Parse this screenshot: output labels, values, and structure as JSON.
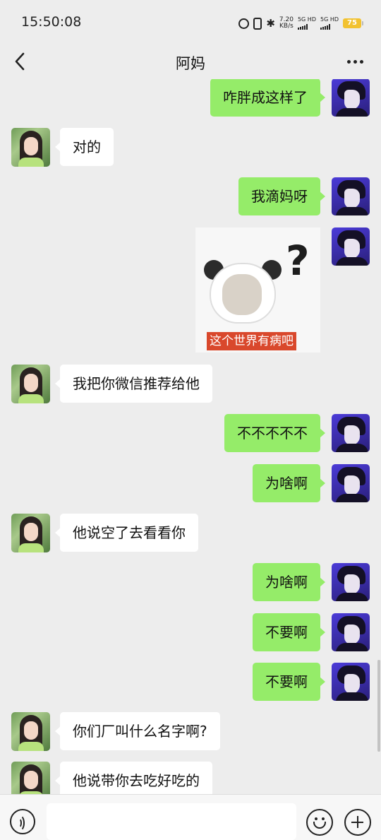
{
  "status_bar": {
    "time": "15:50:08",
    "net_speed_value": "7.20",
    "net_speed_unit": "KB/s",
    "sim1_label": "5G HD",
    "sim2_label": "5G HD",
    "battery": "75",
    "icons": [
      "alarm-icon",
      "vibrate-icon",
      "bluetooth-icon",
      "signal-icon",
      "battery-icon"
    ]
  },
  "header": {
    "title": "阿妈",
    "back_icon": "chevron-left-icon",
    "more_icon": "more-dots-icon"
  },
  "messages": [
    {
      "from": "me",
      "type": "text",
      "text": "咋胖成这样了"
    },
    {
      "from": "mom",
      "type": "text",
      "text": "对的"
    },
    {
      "from": "me",
      "type": "text",
      "text": "我滴妈呀"
    },
    {
      "from": "me",
      "type": "sticker",
      "caption": "这个世界有病吧"
    },
    {
      "from": "mom",
      "type": "text",
      "text": "我把你微信推荐给他"
    },
    {
      "from": "me",
      "type": "text",
      "text": "不不不不不"
    },
    {
      "from": "me",
      "type": "text",
      "text": "为啥啊"
    },
    {
      "from": "mom",
      "type": "text",
      "text": "他说空了去看看你"
    },
    {
      "from": "me",
      "type": "text",
      "text": "为啥啊"
    },
    {
      "from": "me",
      "type": "text",
      "text": "不要啊"
    },
    {
      "from": "me",
      "type": "text",
      "text": "不要啊"
    },
    {
      "from": "mom",
      "type": "text",
      "text": "你们厂叫什么名字啊?"
    },
    {
      "from": "mom",
      "type": "text",
      "text": "他说带你去吃好吃的"
    }
  ],
  "input_bar": {
    "placeholder": "",
    "value": "",
    "voice_icon": "voice-icon",
    "emoji_icon": "emoji-icon",
    "plus_icon": "plus-icon"
  },
  "colors": {
    "background": "#ededed",
    "my_bubble": "#95ec69",
    "their_bubble": "#ffffff",
    "battery": "#f2c230"
  }
}
